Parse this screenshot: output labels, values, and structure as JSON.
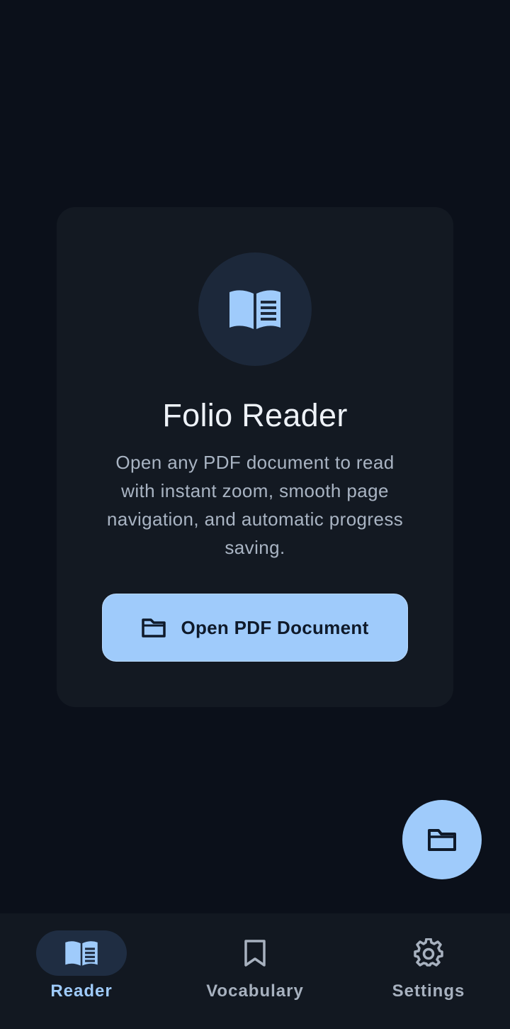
{
  "app": {
    "title": "Folio Reader",
    "description": "Open any PDF document to read with instant zoom, smooth page navigation, and automatic progress saving.",
    "hero_icon": "open-book-icon"
  },
  "open_button": {
    "label": "Open PDF Document",
    "icon": "folder-icon"
  },
  "fab": {
    "icon": "folder-icon"
  },
  "bottom_nav": {
    "items": [
      {
        "label": "Reader",
        "icon": "open-book-icon",
        "active": true
      },
      {
        "label": "Vocabulary",
        "icon": "bookmark-icon",
        "active": false
      },
      {
        "label": "Settings",
        "icon": "gear-icon",
        "active": false
      }
    ]
  },
  "colors": {
    "background": "#0b101a",
    "card": "#131922",
    "accent": "#9fcbfb",
    "text_primary": "#eef2f8",
    "text_secondary": "#a9b4c3"
  }
}
